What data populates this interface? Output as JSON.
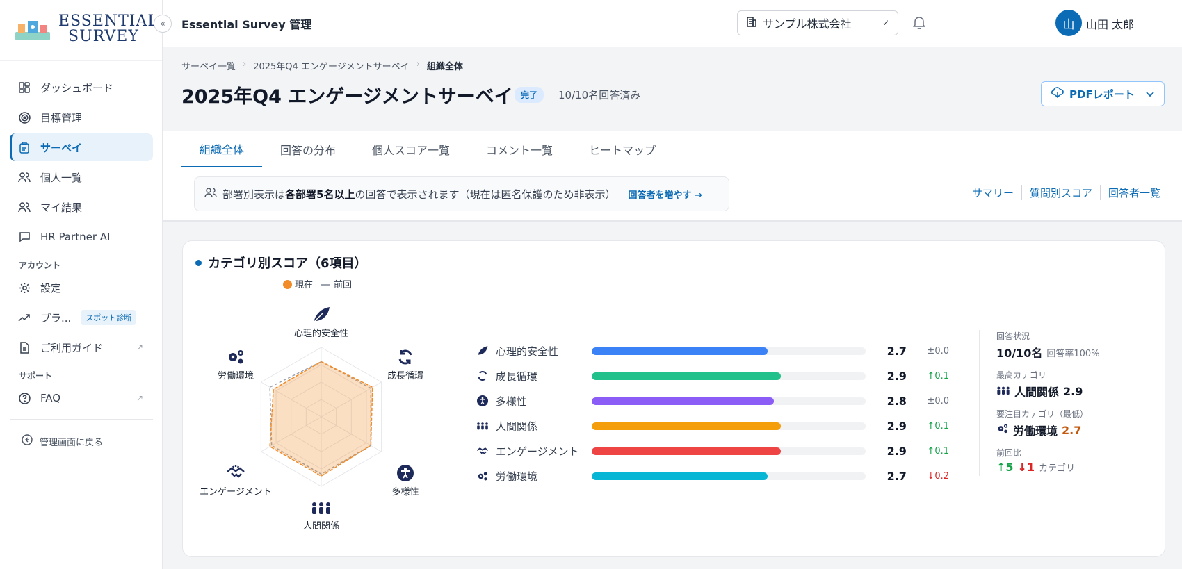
{
  "app": {
    "logo_line1": "ESSENTIAL",
    "logo_line2": "SURVEY",
    "title": "Essential Survey 管理",
    "collapse_icon": "«"
  },
  "sidebar": {
    "items": [
      {
        "label": "ダッシュボード",
        "icon": "dashboard-icon"
      },
      {
        "label": "目標管理",
        "icon": "target-icon"
      },
      {
        "label": "サーベイ",
        "icon": "clipboard-icon"
      },
      {
        "label": "個人一覧",
        "icon": "users-icon"
      },
      {
        "label": "マイ結果",
        "icon": "user-icon"
      },
      {
        "label": "HR Partner AI",
        "icon": "chat-icon"
      }
    ],
    "account_section": "アカウント",
    "account_items": [
      {
        "label": "設定",
        "icon": "gear-icon"
      },
      {
        "label": "プラ...",
        "icon": "trend-icon",
        "badge": "スポット診断"
      },
      {
        "label": "ご利用ガイド",
        "icon": "document-icon"
      }
    ],
    "support_section": "サポート",
    "support_items": [
      {
        "label": "FAQ",
        "icon": "help-icon"
      }
    ],
    "back_label": "管理画面に戻る"
  },
  "topbar": {
    "company": "サンプル株式会社",
    "avatar_initial": "山",
    "user_name": "山田 太郎"
  },
  "page": {
    "breadcrumbs": [
      "サーベイ一覧",
      "2025年Q4 エンゲージメントサーベイ",
      "組織全体"
    ],
    "breadcrumb_sep": "›",
    "title": "2025年Q4 エンゲージメントサーベイ",
    "status": "完了",
    "responses": "10/10名回答済み",
    "pdf_button": "PDFレポート"
  },
  "tabs": [
    "組織全体",
    "回答の分布",
    "個人スコア一覧",
    "コメント一覧",
    "ヒートマップ"
  ],
  "notice": {
    "text_before": "部署別表示は",
    "text_bold": "各部署5名以上",
    "text_after": "の回答で表示されます（現在は匿名保護のため非表示）",
    "link": "回答者を増やす →"
  },
  "view_links": [
    "サマリー",
    "質問別スコア",
    "回答者一覧"
  ],
  "card": {
    "title": "カテゴリ別スコア（6項目）",
    "legend_current": "現在",
    "legend_previous": "前回"
  },
  "chart_data": {
    "type": "radar",
    "max": 5,
    "categories": [
      "心理的安全性",
      "成長循環",
      "多様性",
      "人間関係",
      "エンゲージメント",
      "労働環境"
    ],
    "series": [
      {
        "name": "現在",
        "values": [
          2.7,
          2.9,
          2.8,
          2.9,
          2.9,
          2.7
        ],
        "color": "#f28c28"
      },
      {
        "name": "前回",
        "values": [
          2.7,
          2.8,
          2.8,
          2.8,
          2.8,
          2.9
        ],
        "color": "#9ca3af"
      }
    ]
  },
  "scores": [
    {
      "label": "心理的安全性",
      "value": "2.7",
      "num": 2.7,
      "delta": "±0.0",
      "trend": "flat",
      "color": "#3b82f6",
      "icon": "leaf-icon"
    },
    {
      "label": "成長循環",
      "value": "2.9",
      "num": 2.9,
      "delta": "0.1",
      "trend": "up",
      "color": "#22c08a",
      "icon": "cycle-icon"
    },
    {
      "label": "多様性",
      "value": "2.8",
      "num": 2.8,
      "delta": "±0.0",
      "trend": "flat",
      "color": "#8b5cf6",
      "icon": "accessibility-icon"
    },
    {
      "label": "人間関係",
      "value": "2.9",
      "num": 2.9,
      "delta": "0.1",
      "trend": "up",
      "color": "#f59e0b",
      "icon": "people-icon"
    },
    {
      "label": "エンゲージメント",
      "value": "2.9",
      "num": 2.9,
      "delta": "0.1",
      "trend": "up",
      "color": "#ef4444",
      "icon": "handshake-icon"
    },
    {
      "label": "労働環境",
      "value": "2.7",
      "num": 2.7,
      "delta": "0.2",
      "trend": "down",
      "color": "#06b6d4",
      "icon": "gears-icon"
    }
  ],
  "summary": {
    "status_label": "回答状況",
    "status_value": "10/10名",
    "status_sub": "回答率100%",
    "top_label": "最高カテゴリ",
    "top_name": "人間関係",
    "top_value": "2.9",
    "focus_label": "要注目カテゴリ（最低）",
    "focus_name": "労働環境",
    "focus_value": "2.7",
    "compare_label": "前回比",
    "up_count": "5",
    "down_count": "1",
    "compare_unit": "カテゴリ"
  }
}
